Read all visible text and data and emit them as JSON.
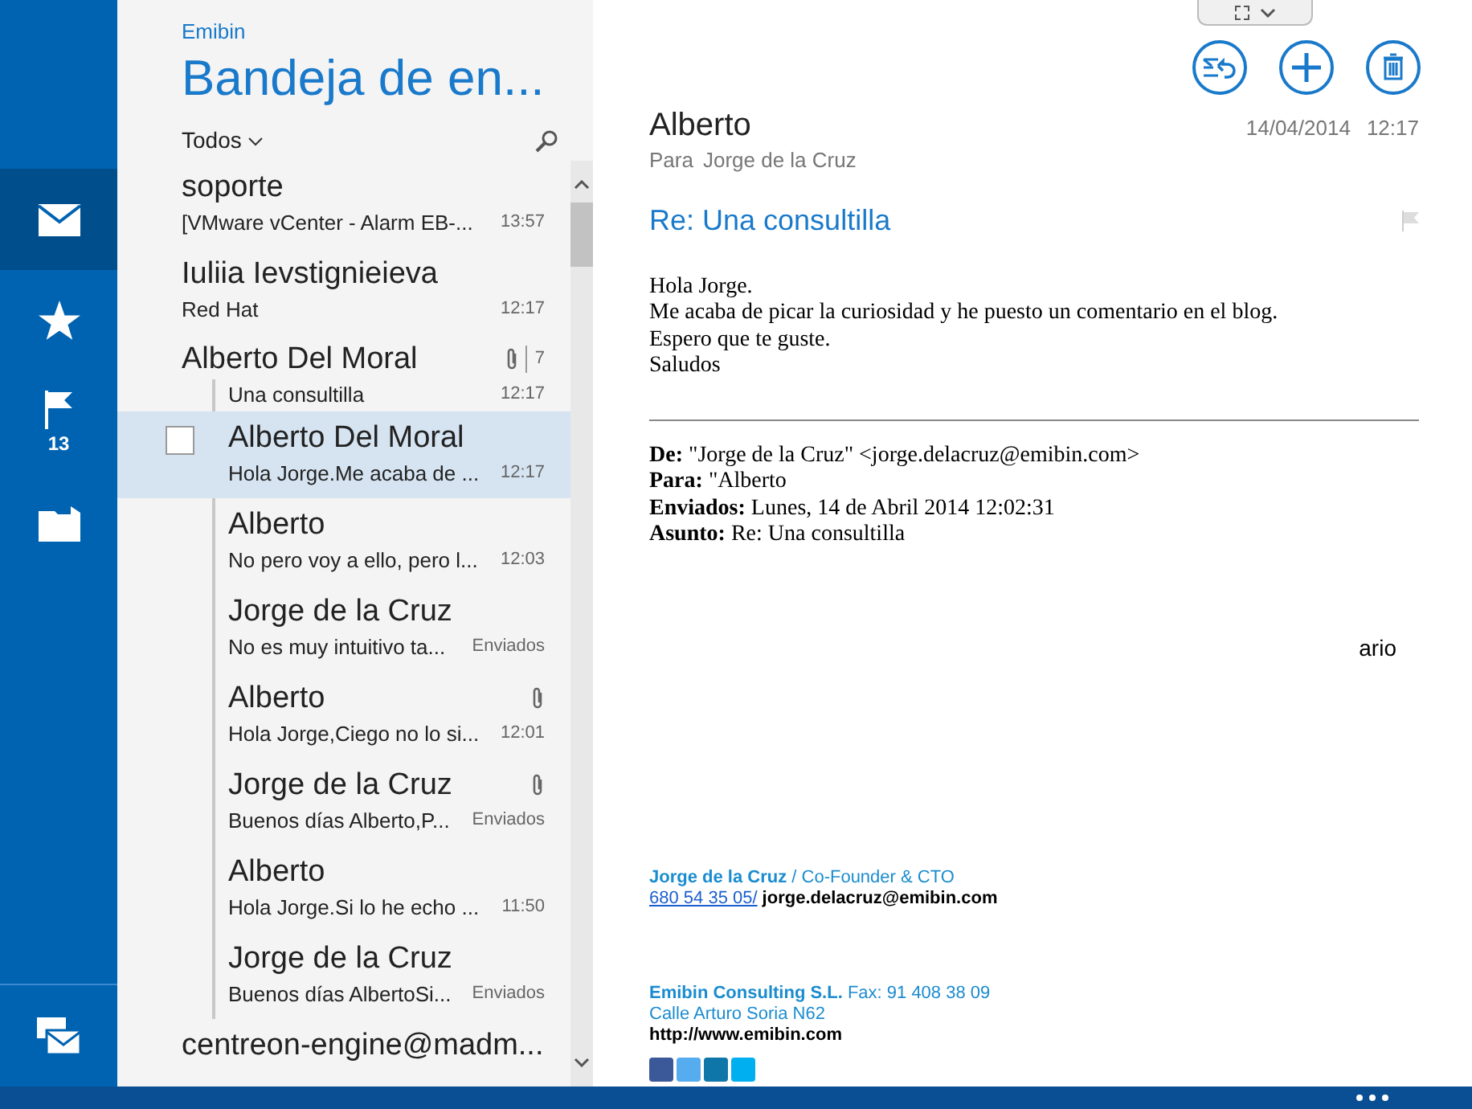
{
  "rail": {
    "items": [
      {
        "kind": "mail",
        "selected": true
      },
      {
        "kind": "star",
        "selected": false
      },
      {
        "kind": "flag",
        "selected": false,
        "count": "13"
      },
      {
        "kind": "folder",
        "selected": false
      }
    ]
  },
  "list": {
    "account": "Emibin",
    "title": "Bandeja de en...",
    "filter": "Todos",
    "messages": [
      {
        "sender": "soporte",
        "preview": "[VMware vCenter - Alarm EB-...",
        "time": "13:57",
        "attachment": false,
        "selected": false
      },
      {
        "sender": "Iuliia Ievstignieieva",
        "preview": "Red Hat",
        "time": "12:17",
        "attachment": false,
        "selected": false
      },
      {
        "sender": "Alberto Del Moral",
        "count": "7",
        "attachment": true,
        "selected": false,
        "children": [
          {
            "preview": "Una consultilla",
            "time": "12:17",
            "attachment": false,
            "selected": false
          },
          {
            "sender": "Alberto Del Moral",
            "preview": "Hola Jorge.Me acaba de ...",
            "time": "12:17",
            "attachment": false,
            "selected": true
          },
          {
            "sender": "Alberto",
            "preview": "No pero voy a ello, pero l...",
            "time": "12:03",
            "attachment": false,
            "selected": false
          },
          {
            "sender": "Jorge de la Cruz",
            "preview": "No es muy intuitivo ta...",
            "time": "Enviados",
            "attachment": false,
            "selected": false
          },
          {
            "sender": "Alberto",
            "preview": "Hola Jorge,Ciego no lo si...",
            "time": "12:01",
            "attachment": true,
            "selected": false
          },
          {
            "sender": "Jorge de la Cruz",
            "preview": "Buenos días Alberto,P...",
            "time": "Enviados",
            "attachment": true,
            "selected": false
          },
          {
            "sender": "Alberto",
            "preview": "Hola Jorge.Si lo he echo ...",
            "time": "11:50",
            "attachment": false,
            "selected": false
          },
          {
            "sender": "Jorge de la Cruz",
            "preview": "Buenos días AlbertoSi...",
            "time": "Enviados",
            "attachment": false,
            "selected": false
          }
        ]
      },
      {
        "sender": "centreon-engine@madm...",
        "attachment": false,
        "selected": false
      }
    ]
  },
  "message": {
    "from": "Alberto",
    "to_label": "Para",
    "to": "Jorge de la Cruz",
    "date": "14/04/2014",
    "time": "12:17",
    "subject": "Re: Una consultilla",
    "body": [
      "Hola Jorge.",
      "Me acaba de picar la curiosidad y he puesto un comentario en el blog.",
      "Espero que te guste.",
      "Saludos"
    ],
    "quoted_headers": [
      {
        "label": "De:",
        "value": "\"Jorge de la Cruz\" <jorge.delacruz@emibin.com>"
      },
      {
        "label": "Para:",
        "value": "\"Alberto"
      },
      {
        "label": "Enviados:",
        "value": "Lunes, 14 de Abril 2014 12:02:31"
      },
      {
        "label": "Asunto:",
        "value": "Re: Una consultilla"
      }
    ],
    "fragment": "ario",
    "signature": {
      "name": "Jorge de la Cruz",
      "role": "/ Co-Founder & CTO",
      "phone": "680 54 35 05/",
      "email": "jorge.delacruz@emibin.com",
      "company": "Emibin Consulting S.L.",
      "fax": "Fax: 91 408 38 09",
      "address": "Calle Arturo Soria N62",
      "web": "http://www.emibin.com"
    }
  }
}
